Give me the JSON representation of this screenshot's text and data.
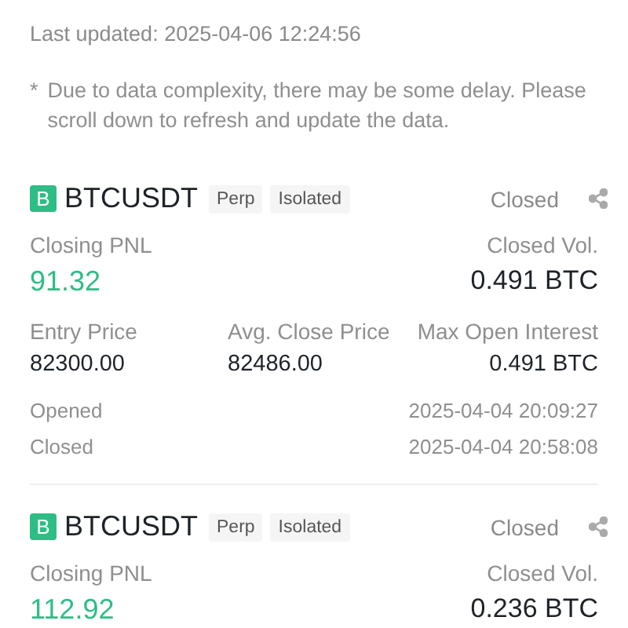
{
  "last_updated": "Last updated: 2025-04-06 12:24:56",
  "notice": {
    "mark": "*",
    "text": "Due to data complexity, there may be some delay. Please scroll down to refresh and update the data."
  },
  "positions": [
    {
      "side_badge": "B",
      "symbol": "BTCUSDT",
      "tags": [
        "Perp",
        "Isolated"
      ],
      "status": "Closed",
      "pnl_label": "Closing PNL",
      "pnl": "91.32",
      "vol_label": "Closed Vol.",
      "vol": "0.491 BTC",
      "details": [
        {
          "label": "Entry Price",
          "value": "82300.00"
        },
        {
          "label": "Avg. Close Price",
          "value": "82486.00"
        },
        {
          "label": "Max Open Interest",
          "value": "0.491 BTC"
        }
      ],
      "times": [
        {
          "label": "Opened",
          "value": "2025-04-04 20:09:27"
        },
        {
          "label": "Closed",
          "value": "2025-04-04 20:58:08"
        }
      ]
    },
    {
      "side_badge": "B",
      "symbol": "BTCUSDT",
      "tags": [
        "Perp",
        "Isolated"
      ],
      "status": "Closed",
      "pnl_label": "Closing PNL",
      "pnl": "112.92",
      "vol_label": "Closed Vol.",
      "vol": "0.236 BTC"
    }
  ]
}
